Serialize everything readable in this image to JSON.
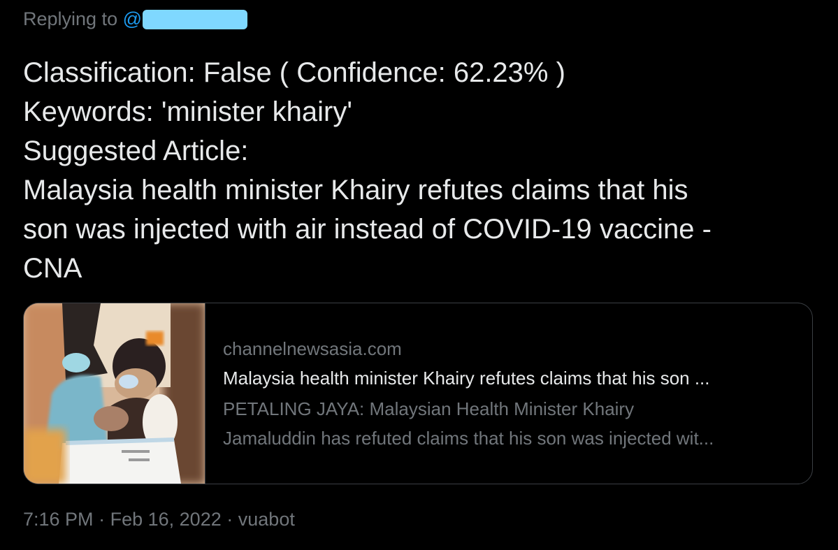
{
  "reply": {
    "prefix": "Replying to",
    "at": "@"
  },
  "tweet": {
    "lines": [
      "Classification: False ( Confidence: 62.23% )",
      "Keywords: 'minister khairy'",
      "Suggested Article:",
      "Malaysia health minister Khairy refutes claims that his",
      "son was injected with air instead of COVID-19 vaccine -",
      "CNA"
    ]
  },
  "card": {
    "domain": "channelnewsasia.com",
    "title": "Malaysia health minister Khairy refutes claims that his son ...",
    "description_lines": [
      "PETALING JAYA: Malaysian Health Minister Khairy",
      "Jamaluddin has refuted claims that his son was injected wit..."
    ]
  },
  "meta": {
    "time": "7:16 PM",
    "separator": "·",
    "date": "Feb 16, 2022",
    "source": "vuabot"
  },
  "colors": {
    "background": "#000000",
    "text_primary": "#e7e9ea",
    "text_secondary": "#71767b",
    "link": "#1d9bf0",
    "card_border": "#3b3f44",
    "redaction": "#7fd8ff"
  }
}
